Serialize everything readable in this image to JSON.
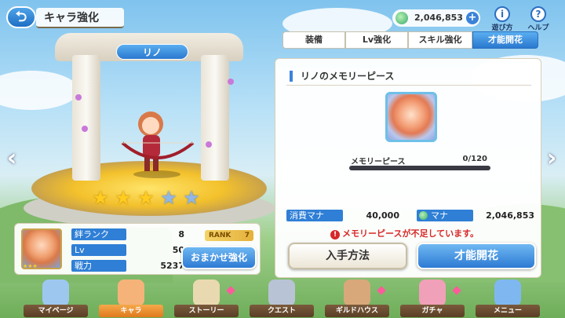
{
  "header": {
    "back_icon": "back-arrow-icon",
    "title": "キャラ強化",
    "mana": "2,046,853",
    "help_label": "遊び方",
    "help_icon": "info-icon",
    "menu_label": "ヘルプ",
    "menu_icon": "question-icon"
  },
  "character": {
    "name": "リノ",
    "stars_filled": 3,
    "stars_total": 5
  },
  "stats": {
    "rows": [
      {
        "label": "絆ランク",
        "value": "8"
      },
      {
        "label": "Lv",
        "value": "50"
      },
      {
        "label": "戦力",
        "value": "5237"
      }
    ],
    "rank_label": "RANK",
    "rank_value": "7",
    "auto_button": "おまかせ強化"
  },
  "tabs": [
    {
      "label": "装備",
      "active": false
    },
    {
      "label": "Lv強化",
      "active": false
    },
    {
      "label": "スキル強化",
      "active": false
    },
    {
      "label": "才能開花",
      "active": true
    }
  ],
  "memory": {
    "header": "リノのメモリーピース",
    "piece_label": "メモリーピース",
    "piece_count": "0/120",
    "progress": 0,
    "cost_label": "消費マナ",
    "cost_value": "40,000",
    "mana_label": "マナ",
    "mana_value": "2,046,853",
    "warning": "メモリーピースが不足しています。",
    "obtain_button": "入手方法",
    "awaken_button": "才能開花"
  },
  "nav": [
    {
      "label": "マイページ",
      "icon": "castle-icon",
      "active": false,
      "badge": false
    },
    {
      "label": "キャラ",
      "icon": "character-icon",
      "active": true,
      "badge": false
    },
    {
      "label": "ストーリー",
      "icon": "scroll-icon",
      "active": false,
      "badge": true
    },
    {
      "label": "クエスト",
      "icon": "swords-icon",
      "active": false,
      "badge": false
    },
    {
      "label": "ギルドハウス",
      "icon": "house-icon",
      "active": false,
      "badge": true
    },
    {
      "label": "ガチャ",
      "icon": "gacha-icon",
      "active": false,
      "badge": true
    },
    {
      "label": "メニュー",
      "icon": "crystal-icon",
      "active": false,
      "badge": false
    }
  ],
  "colors": {
    "accent_blue": "#2d7ad4",
    "warning_red": "#d62828",
    "star_gold": "#ffcc1f"
  }
}
